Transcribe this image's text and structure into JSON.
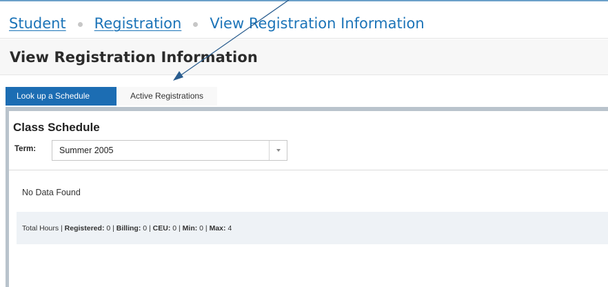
{
  "breadcrumb": {
    "items": [
      "Student",
      "Registration"
    ],
    "current": "View Registration Information"
  },
  "page": {
    "title": "View Registration Information"
  },
  "tabs": [
    {
      "label": "Look up a Schedule",
      "active": true
    },
    {
      "label": "Active Registrations",
      "active": false
    }
  ],
  "class_schedule": {
    "title": "Class Schedule",
    "term_label": "Term:",
    "term_value": "Summer 2005",
    "empty_message": "No Data Found"
  },
  "totals": {
    "prefix": "Total Hours",
    "registered_label": "Registered:",
    "registered_value": "0",
    "billing_label": "Billing:",
    "billing_value": "0",
    "ceu_label": "CEU:",
    "ceu_value": "0",
    "min_label": "Min:",
    "min_value": "0",
    "max_label": "Max:",
    "max_value": "4"
  },
  "colors": {
    "accent": "#1c6db3",
    "link": "#1c74b8",
    "annotation_arrow": "#2a5d8f"
  },
  "icons": {
    "dropdown": "chevron-down-icon"
  }
}
